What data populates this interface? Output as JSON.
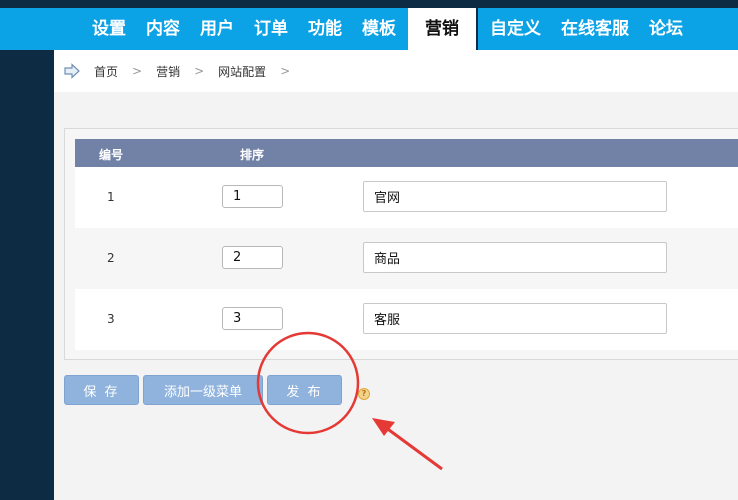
{
  "nav": {
    "items": [
      {
        "label": "设置"
      },
      {
        "label": "内容"
      },
      {
        "label": "用户"
      },
      {
        "label": "订单"
      },
      {
        "label": "功能"
      },
      {
        "label": "模板"
      },
      {
        "label": "营销",
        "active": true
      },
      {
        "label": "自定义"
      },
      {
        "label": "在线客服"
      },
      {
        "label": "论坛"
      }
    ]
  },
  "breadcrumb": {
    "home_icon": "home-arrow-icon",
    "items": [
      "首页",
      "营销",
      "网站配置"
    ],
    "separator": ">"
  },
  "table": {
    "headers": {
      "id": "编号",
      "sort": "排序"
    },
    "rows": [
      {
        "id": "1",
        "sort": "1",
        "name": "官网"
      },
      {
        "id": "2",
        "sort": "2",
        "name": "商品"
      },
      {
        "id": "3",
        "sort": "3",
        "name": "客服"
      }
    ]
  },
  "actions": {
    "save_label": "保 存",
    "add_menu_label": "添加一级菜单",
    "publish_label": "发 布",
    "help_icon": "help-icon"
  },
  "colors": {
    "topbar_bg": "#0d2b43",
    "nav_bg": "#0ba2e6",
    "table_header_bg": "#7282a7",
    "button_bg": "#8fb3dd",
    "annotation_red": "#e53935"
  }
}
